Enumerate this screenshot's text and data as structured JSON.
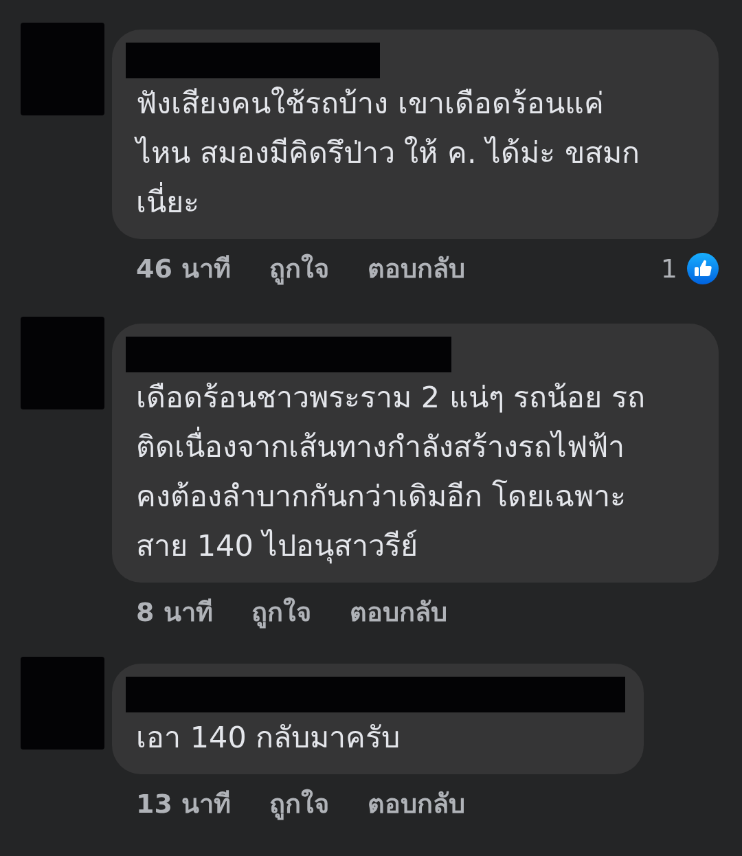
{
  "comments": [
    {
      "text_lines": [
        "ฟังเสียงคนใช้รถบ้าง เขาเดือดร้อนแค่",
        "ไหน สมองมีคิดรึป่าว ให้ ค. ได้ม่ะ ขสมก",
        "เนี่ยะ"
      ],
      "time": "46 นาที",
      "like_label": "ถูกใจ",
      "reply_label": "ตอบกลับ",
      "reaction_count": "1"
    },
    {
      "text_lines": [
        "เดือดร้อนชาวพระราม 2 แน่ๆ รถน้อย รถ",
        "ติดเนื่องจากเส้นทางกำลังสร้างรถไฟฟ้า",
        "คงต้องลำบากกันกว่าเดิมอีก โดยเฉพาะ",
        "สาย 140 ไปอนุสาวรีย์"
      ],
      "time": "8 นาที",
      "like_label": "ถูกใจ",
      "reply_label": "ตอบกลับ"
    },
    {
      "text_lines": [
        "เอา 140 กลับมาครับ"
      ],
      "time": "13 นาที",
      "like_label": "ถูกใจ",
      "reply_label": "ตอบกลับ"
    }
  ]
}
